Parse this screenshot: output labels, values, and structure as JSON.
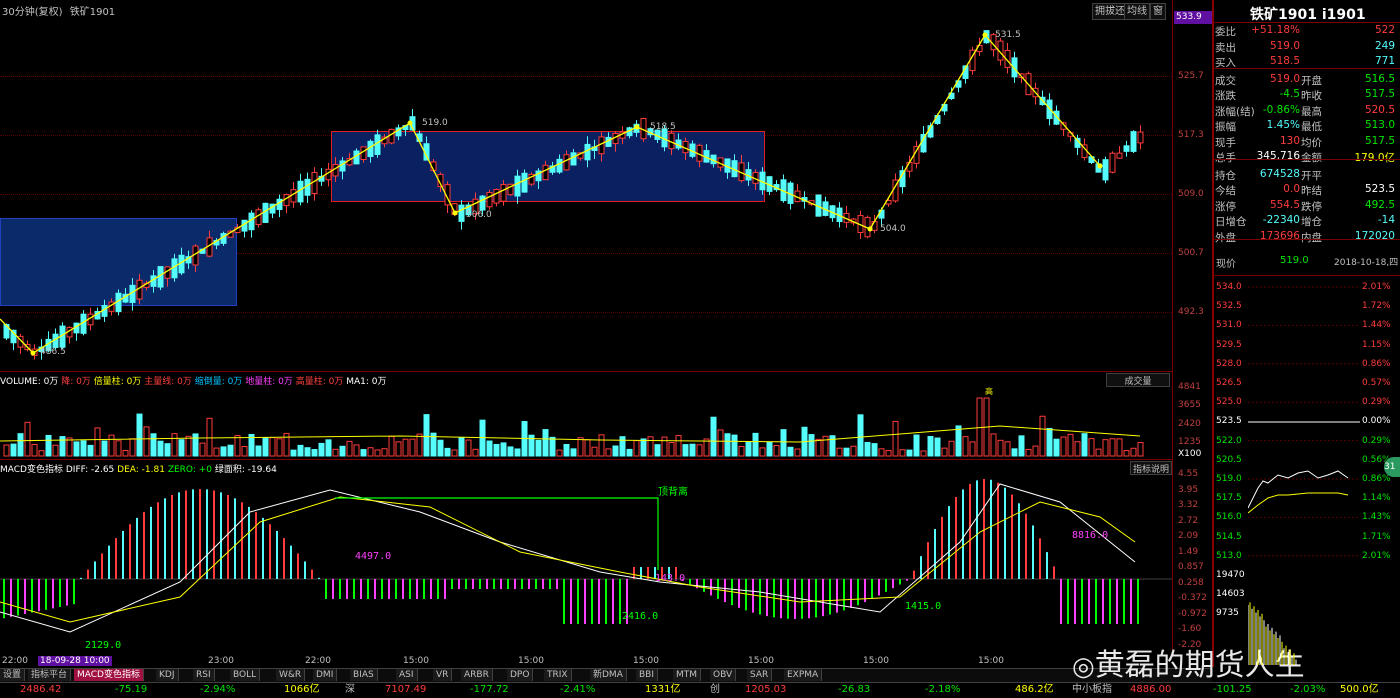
{
  "header": {
    "period": "30分钟(复权)",
    "name": "铁矿1901",
    "btn_restore": "拥拔还",
    "btn_avg": "均线",
    "btn_win": "窗",
    "cur_price_tag": "533.9"
  },
  "price_axis": [
    "525.7",
    "517.3",
    "509.0",
    "500.7",
    "492.3"
  ],
  "zigzag_labels": [
    "486.5",
    "519.0",
    "506.0",
    "518.5",
    "504.0",
    "531.5"
  ],
  "volume_bar": {
    "title": "VOLUME: 0万",
    "items": [
      "降: 0万",
      "倍量柱: 0万",
      "主量线: 0万",
      "缩倒量: 0万",
      "地量柱: 0万",
      "高量柱: 0万",
      "MA1: 0万"
    ],
    "dropdown": "成交量",
    "axis": [
      "4841",
      "3655",
      "2420",
      "1235"
    ],
    "unit": "X100",
    "high_tag": "高"
  },
  "macd": {
    "title": "MACD变色指标",
    "diff": "DIFF: -2.65",
    "dea": "DEA: -1.81",
    "zero": "ZERO: +0",
    "green_area": "绿面积: -19.64",
    "help_btn": "指标说明",
    "divergence": "顶背离",
    "annotations": [
      "4497.0",
      "2129.0",
      "143.0",
      "2416.0",
      "1415.0",
      "8816.0"
    ],
    "axis": [
      "4.55",
      "3.95",
      "3.32",
      "2.72",
      "2.09",
      "1.49",
      "0.857",
      "0.258",
      "-0.372",
      "-0.972",
      "-1.60",
      "-2.20"
    ]
  },
  "time_axis": [
    "22:00",
    "18-09-28 10:00",
    "23:00",
    "22:00",
    "15:00",
    "15:00",
    "15:00",
    "15:00",
    "15:00",
    "15:00"
  ],
  "tabs": [
    "设置",
    "指标平台",
    "MACD变色指标",
    "KDJ",
    "RSI",
    "BOLL",
    "W&R",
    "DMI",
    "BIAS",
    "ASI",
    "VR",
    "ARBR",
    "DPO",
    "TRIX",
    "新DMA",
    "BBI",
    "MTM",
    "OBV",
    "SAR",
    "EXPMA"
  ],
  "bottom_bar": [
    {
      "v": "2486.42",
      "c": "red"
    },
    {
      "v": "-75.19",
      "c": "grn"
    },
    {
      "v": "-2.94%",
      "c": "grn"
    },
    {
      "v": "1066亿",
      "c": "yel"
    },
    {
      "v": "深",
      "c": "wht"
    },
    {
      "v": "7107.49",
      "c": "red"
    },
    {
      "v": "-177.72",
      "c": "grn"
    },
    {
      "v": "-2.41%",
      "c": "grn"
    },
    {
      "v": "1331亿",
      "c": "yel"
    },
    {
      "v": "创",
      "c": "wht"
    },
    {
      "v": "1205.03",
      "c": "red"
    },
    {
      "v": "-26.83",
      "c": "grn"
    },
    {
      "v": "-2.18%",
      "c": "grn"
    },
    {
      "v": "486.2亿",
      "c": "yel"
    },
    {
      "v": "中小板指",
      "c": "wht"
    },
    {
      "v": "4886.00",
      "c": "red"
    },
    {
      "v": "-101.25",
      "c": "grn"
    },
    {
      "v": "-2.03%",
      "c": "grn"
    },
    {
      "v": "500.0亿",
      "c": "yel"
    }
  ],
  "watermark": "黄磊的期货人生",
  "right_panel": {
    "title": "铁矿1901 i1901",
    "rows": [
      {
        "l1": "委比",
        "v1": "+51.18%",
        "c1": "red",
        "l2": "",
        "v2": "522",
        "c2": "red"
      },
      {
        "l1": "卖出",
        "v1": "519.0",
        "c1": "red",
        "l2": "",
        "v2": "249",
        "c2": "cyn"
      },
      {
        "l1": "买入",
        "v1": "518.5",
        "c1": "red",
        "l2": "",
        "v2": "771",
        "c2": "cyn"
      },
      {
        "l1": "成交",
        "v1": "519.0",
        "c1": "red",
        "l2": "开盘",
        "v2": "516.5",
        "c2": "grn"
      },
      {
        "l1": "涨跌",
        "v1": "-4.5",
        "c1": "grn",
        "l2": "昨收",
        "v2": "517.5",
        "c2": "grn"
      },
      {
        "l1": "涨幅(结)",
        "v1": "-0.86%",
        "c1": "grn",
        "l2": "最高",
        "v2": "520.5",
        "c2": "red"
      },
      {
        "l1": "振幅",
        "v1": "1.45%",
        "c1": "cyn",
        "l2": "最低",
        "v2": "513.0",
        "c2": "grn"
      },
      {
        "l1": "现手",
        "v1": "130",
        "c1": "red",
        "l2": "均价",
        "v2": "517.5",
        "c2": "grn"
      },
      {
        "l1": "总手",
        "v1": "345,716",
        "c1": "wht",
        "l2": "金额",
        "v2": "179.0亿",
        "c2": "yel"
      },
      {
        "l1": "持仓",
        "v1": "674528",
        "c1": "cyn",
        "l2": "开平",
        "v2": "",
        "c2": "wht"
      },
      {
        "l1": "今结",
        "v1": "0.0",
        "c1": "red",
        "l2": "昨结",
        "v2": "523.5",
        "c2": "wht"
      },
      {
        "l1": "涨停",
        "v1": "554.5",
        "c1": "red",
        "l2": "跌停",
        "v2": "492.5",
        "c2": "grn"
      },
      {
        "l1": "日增仓",
        "v1": "-22340",
        "c1": "cyn",
        "l2": "增仓",
        "v2": "-14",
        "c2": "cyn"
      },
      {
        "l1": "外盘",
        "v1": "173696",
        "c1": "red",
        "l2": "内盘",
        "v2": "172020",
        "c2": "cyn"
      }
    ],
    "price_now_label": "现价",
    "price_now": "519.0",
    "date": "2018-10-18,四",
    "mini_left": [
      "534.0",
      "532.5",
      "531.0",
      "529.5",
      "528.0",
      "526.5",
      "525.0",
      "523.5",
      "522.0",
      "520.5",
      "519.0",
      "517.5",
      "516.0",
      "514.5",
      "513.0",
      "19470",
      "14603",
      "9735"
    ],
    "mini_right": [
      "2.01%",
      "1.72%",
      "1.44%",
      "1.15%",
      "0.86%",
      "0.57%",
      "0.29%",
      "0.00%",
      "0.29%",
      "0.56%",
      "0.86%",
      "1.14%",
      "1.43%",
      "1.71%",
      "2.01%"
    ]
  }
}
